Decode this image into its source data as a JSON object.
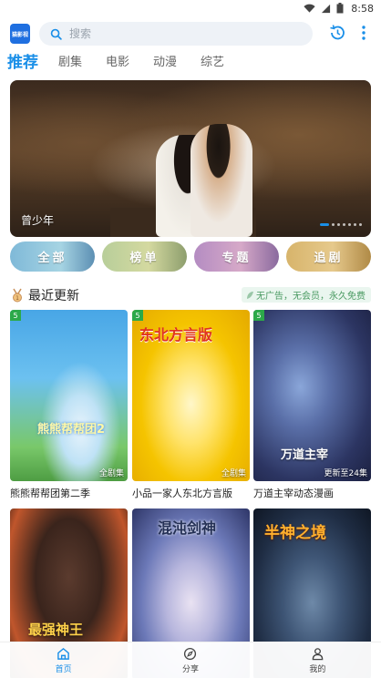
{
  "status_bar": {
    "time": "8:58"
  },
  "header": {
    "logo_text": "猫影视",
    "search_placeholder": "搜索"
  },
  "tabs": [
    {
      "label": "推荐",
      "active": true
    },
    {
      "label": "剧集",
      "active": false
    },
    {
      "label": "电影",
      "active": false
    },
    {
      "label": "动漫",
      "active": false
    },
    {
      "label": "综艺",
      "active": false
    }
  ],
  "banner": {
    "caption": "曾少年",
    "slide_count": 7,
    "active_slide": 1
  },
  "quick_categories": [
    {
      "label": "全部"
    },
    {
      "label": "榜单"
    },
    {
      "label": "专题"
    },
    {
      "label": "追剧"
    }
  ],
  "section": {
    "title": "最近更新",
    "ad_free_note": "无广告，无会员，永久免费"
  },
  "cards": [
    {
      "title": "熊熊帮帮团第二季",
      "badge": "5",
      "episode": "全剧集",
      "cover_text": "熊熊帮帮团2"
    },
    {
      "title": "小品一家人东北方言版",
      "badge": "5",
      "episode": "全剧集",
      "cover_text": "东北方言版"
    },
    {
      "title": "万道主宰动态漫画",
      "badge": "5",
      "episode": "更新至24集",
      "cover_text": "万道主宰"
    },
    {
      "title": "",
      "badge": "",
      "episode": "",
      "cover_text": "最强神王"
    },
    {
      "title": "",
      "badge": "",
      "episode": "",
      "cover_text": "混沌剑神"
    },
    {
      "title": "",
      "badge": "",
      "episode": "",
      "cover_text": "半神之境"
    }
  ],
  "bottom_nav": [
    {
      "label": "首页",
      "icon": "home-icon",
      "active": true
    },
    {
      "label": "分享",
      "icon": "compass-icon",
      "active": false
    },
    {
      "label": "我的",
      "icon": "user-icon",
      "active": false
    }
  ],
  "colors": {
    "accent": "#1a8fe8",
    "rating_badge": "#2ca94a",
    "ad_free_text": "#4a9a62"
  }
}
